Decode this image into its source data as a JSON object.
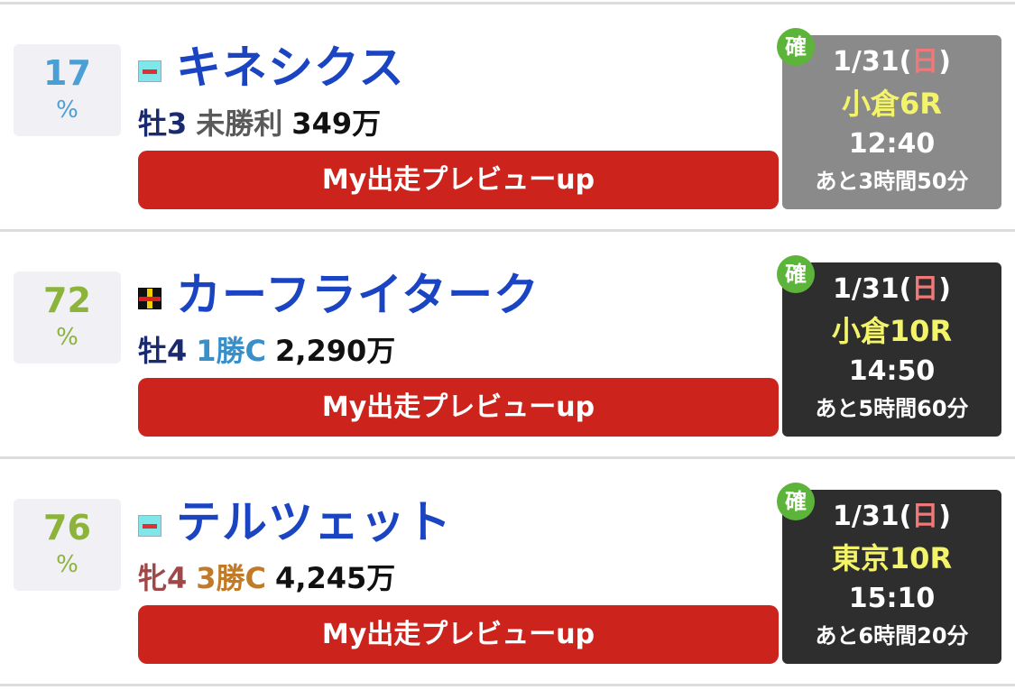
{
  "rows": [
    {
      "percent": "17",
      "percent_sign": "%",
      "percent_color": "#4a9fd5",
      "silk": "cyan-red-bar",
      "name": "キネシクス",
      "sex_age": "牡3",
      "sex_age_color": "#1a2a6e",
      "class": "未勝利",
      "class_color": "#5a5a5a",
      "prize": "349万",
      "button": "My出走プレビューup",
      "badge": "確",
      "date_prefix": "1/31(",
      "date_day": "日",
      "date_suffix": ")",
      "venue": "小倉6R",
      "time": "12:40",
      "remaining": "あと3時間50分",
      "box_color": "#8a8a8a"
    },
    {
      "percent": "72",
      "percent_sign": "%",
      "percent_color": "#8cb33a",
      "silk": "black-yellow-red",
      "name": "カーフライターク",
      "sex_age": "牡4",
      "sex_age_color": "#1a2a6e",
      "class": "1勝C",
      "class_color": "#3a8fc8",
      "prize": "2,290万",
      "button": "My出走プレビューup",
      "badge": "確",
      "date_prefix": "1/31(",
      "date_day": "日",
      "date_suffix": ")",
      "venue": "小倉10R",
      "time": "14:50",
      "remaining": "あと5時間60分",
      "box_color": "#2e2e2e"
    },
    {
      "percent": "76",
      "percent_sign": "%",
      "percent_color": "#8cb33a",
      "silk": "cyan-red-bar",
      "name": "テルツェット",
      "sex_age": "牝4",
      "sex_age_color": "#a04848",
      "class": "3勝C",
      "class_color": "#c07a28",
      "prize": "4,245万",
      "button": "My出走プレビューup",
      "badge": "確",
      "date_prefix": "1/31(",
      "date_day": "日",
      "date_suffix": ")",
      "venue": "東京10R",
      "time": "15:10",
      "remaining": "あと6時間20分",
      "box_color": "#2e2e2e"
    }
  ]
}
